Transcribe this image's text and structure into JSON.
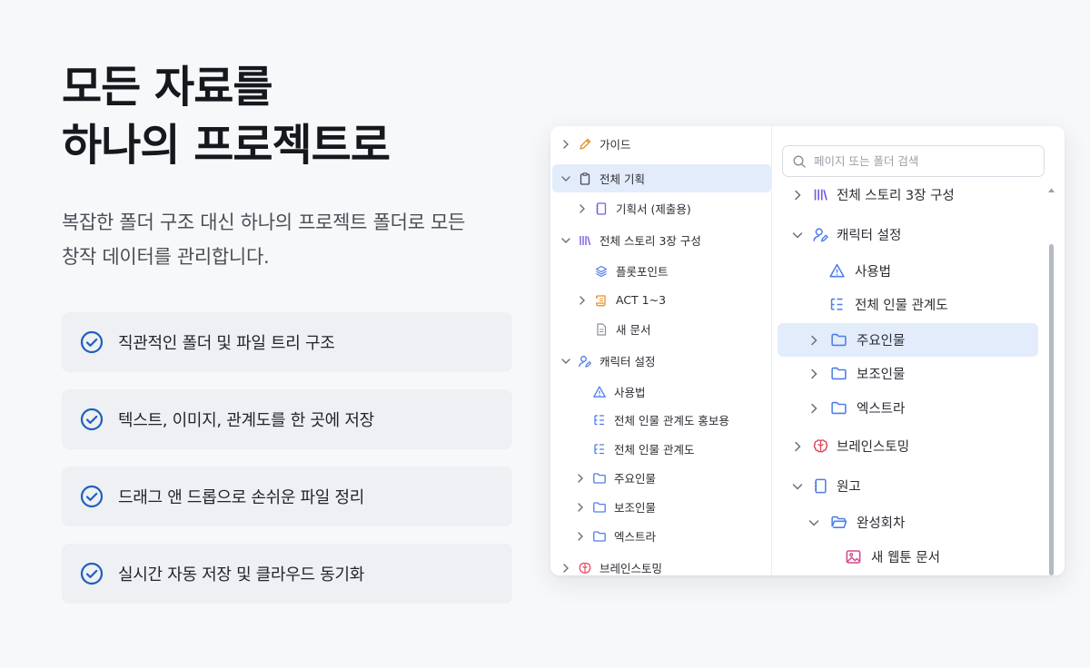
{
  "hero": {
    "title_line1": "모든 자료를",
    "title_line2": "하나의 프로젝트로",
    "subtitle_line1": "복잡한 폴더 구조 대신 하나의 프로젝트 폴더로 모든",
    "subtitle_line2": "창작 데이터를 관리합니다."
  },
  "features": [
    {
      "label": "직관적인 폴더 및 파일 트리 구조"
    },
    {
      "label": "텍스트, 이미지, 관계도를 한 곳에 저장"
    },
    {
      "label": "드래그 앤 드롭으로 손쉬운 파일 정리"
    },
    {
      "label": "실시간 자동 저장 및 클라우드 동기화"
    }
  ],
  "left_tree": [
    {
      "label": "가이드",
      "icon": "pencil-icon",
      "state": "collapsed"
    },
    {
      "label": "전체 기획",
      "icon": "clipboard-icon",
      "state": "expanded",
      "selected": true
    },
    {
      "label": "기획서 (제출용)",
      "icon": "notebook-icon",
      "state": "collapsed"
    },
    {
      "label": "전체 스토리 3장 구성",
      "icon": "library-icon",
      "state": "expanded"
    },
    {
      "label": "플롯포인트",
      "icon": "layers-icon"
    },
    {
      "label": "ACT 1~3",
      "icon": "scroll-icon",
      "state": "collapsed"
    },
    {
      "label": "새 문서",
      "icon": "document-icon"
    },
    {
      "label": "캐릭터 설정",
      "icon": "user-edit-icon",
      "state": "expanded"
    },
    {
      "label": "사용법",
      "icon": "warning-icon"
    },
    {
      "label": "전체 인물 관계도 홍보용",
      "icon": "hierarchy-icon"
    },
    {
      "label": "전체 인물 관계도",
      "icon": "hierarchy-icon"
    },
    {
      "label": "주요인물",
      "icon": "folder-icon",
      "state": "collapsed"
    },
    {
      "label": "보조인물",
      "icon": "folder-icon",
      "state": "collapsed"
    },
    {
      "label": "엑스트라",
      "icon": "folder-icon",
      "state": "collapsed"
    },
    {
      "label": "브레인스토밍",
      "icon": "brain-icon",
      "state": "collapsed"
    }
  ],
  "search": {
    "placeholder": "페이지 또는 폴더 검색",
    "value": ""
  },
  "right_tree": [
    {
      "label": "전체 스토리 3장 구성",
      "icon": "library-icon",
      "state": "collapsed"
    },
    {
      "label": "캐릭터 설정",
      "icon": "user-edit-icon",
      "state": "expanded"
    },
    {
      "label": "사용법",
      "icon": "warning-icon"
    },
    {
      "label": "전체 인물 관계도",
      "icon": "hierarchy-icon"
    },
    {
      "label": "주요인물",
      "icon": "folder-icon",
      "state": "collapsed",
      "selected": true
    },
    {
      "label": "보조인물",
      "icon": "folder-icon",
      "state": "collapsed"
    },
    {
      "label": "엑스트라",
      "icon": "folder-icon",
      "state": "collapsed"
    },
    {
      "label": "브레인스토밍",
      "icon": "brain-icon",
      "state": "collapsed"
    },
    {
      "label": "원고",
      "icon": "notebook-icon",
      "state": "expanded"
    },
    {
      "label": "완성회차",
      "icon": "folder-open-icon",
      "state": "expanded"
    },
    {
      "label": "새 웹툰 문서",
      "icon": "image-icon"
    }
  ],
  "colors": {
    "accent": "#1f5fbf",
    "selection": "#e3ecfb",
    "icon_blue": "#4f7ee8",
    "icon_purple": "#7a5ae0",
    "icon_orange": "#e8902a",
    "icon_red": "#e0455a",
    "icon_pink": "#d6468c"
  }
}
